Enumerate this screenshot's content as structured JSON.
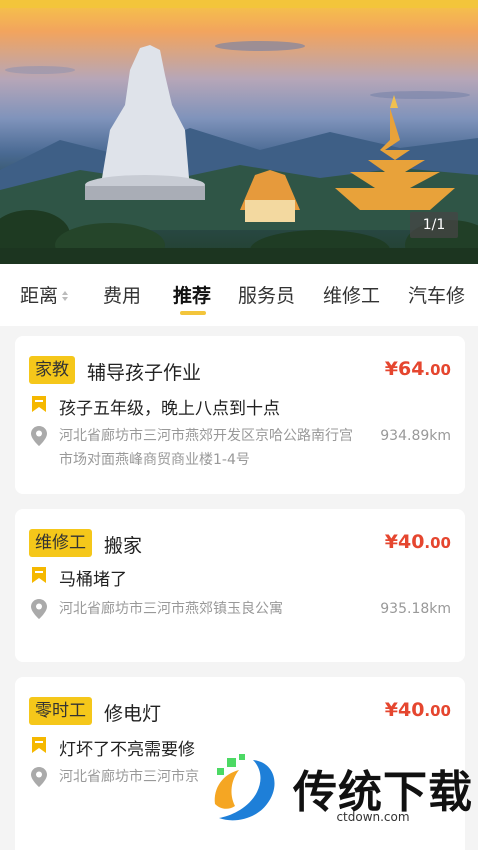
{
  "banner": {
    "counter": "1/1"
  },
  "tabs": [
    {
      "label": "距离"
    },
    {
      "label": "费用"
    },
    {
      "label": "推荐"
    },
    {
      "label": "服务员"
    },
    {
      "label": "维修工"
    },
    {
      "label": "汽车修"
    }
  ],
  "active_tab": "推荐",
  "cards": [
    {
      "tag": "家教",
      "title": "辅导孩子作业",
      "price_main": "¥64",
      "price_decimal": ".00",
      "desc": "孩子五年级，晚上八点到十点",
      "address": "河北省廊坊市三河市燕郊开发区京哈公路南行宫市场对面燕峰商贸商业楼1-4号",
      "distance": "934.89km"
    },
    {
      "tag": "维修工",
      "title": "搬家",
      "price_main": "¥40",
      "price_decimal": ".00",
      "desc": "马桶堵了",
      "address": "河北省廊坊市三河市燕郊镇玉良公寓",
      "distance": "935.18km"
    },
    {
      "tag": "零时工",
      "title": "修电灯",
      "price_main": "¥40",
      "price_decimal": ".00",
      "desc": "灯坏了不亮需要修",
      "address": "河北省廊坊市三河市京",
      "distance": ""
    }
  ],
  "watermark": {
    "text": "传统下载",
    "url": "ctdown.com"
  },
  "colors": {
    "accent": "#f3c53b",
    "tag_bg": "#f5c71a",
    "price": "#e5462f"
  },
  "icons": [
    "message-flag-icon",
    "location-pin-icon",
    "sort-arrows-icon"
  ]
}
